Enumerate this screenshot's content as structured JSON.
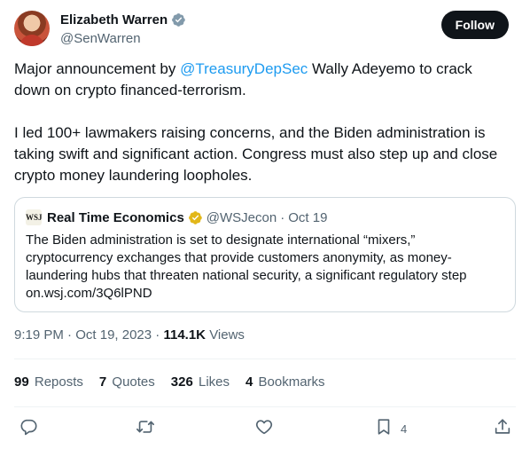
{
  "author": {
    "name": "Elizabeth Warren",
    "handle": "@SenWarren",
    "follow_label": "Follow"
  },
  "tweet": {
    "para1_prefix": "Major announcement by ",
    "para1_mention": "@TreasuryDepSec",
    "para1_suffix": " Wally Adeyemo to crack down on crypto financed-terrorism.",
    "para2": "I led 100+ lawmakers raising concerns, and the Biden administration is taking swift and significant action. Congress must also step up and close crypto money laundering loopholes."
  },
  "quote": {
    "logo_text": "WSJ",
    "name": "Real Time Economics",
    "handle": "@WSJecon",
    "separator": "·",
    "date": "Oct 19",
    "text": "The Biden administration is set to designate international “mixers,” cryptocurrency exchanges that provide customers anonymity, as money-laundering hubs that threaten national security, a significant regulatory step on.wsj.com/3Q6lPND"
  },
  "meta": {
    "time": "9:19 PM",
    "separator": "·",
    "date": "Oct 19, 2023",
    "views_count": "114.1K",
    "views_label": "Views"
  },
  "stats": {
    "reposts_count": "99",
    "reposts_label": "Reposts",
    "quotes_count": "7",
    "quotes_label": "Quotes",
    "likes_count": "326",
    "likes_label": "Likes",
    "bookmarks_count": "4",
    "bookmarks_label": "Bookmarks"
  },
  "actions": {
    "bookmark_count": "4"
  },
  "icons": {
    "author_badge": "verified-gray-icon",
    "quote_badge": "verified-gold-icon",
    "reply": "reply-icon",
    "retweet": "retweet-icon",
    "like": "heart-icon",
    "bookmark": "bookmark-icon",
    "share": "share-icon"
  },
  "colors": {
    "link": "#1d9bf0",
    "follow_bg": "#0f1419",
    "muted": "#536471",
    "border": "#cfd9de",
    "gold_badge": "#e2b719",
    "gray_badge": "#829aab"
  }
}
